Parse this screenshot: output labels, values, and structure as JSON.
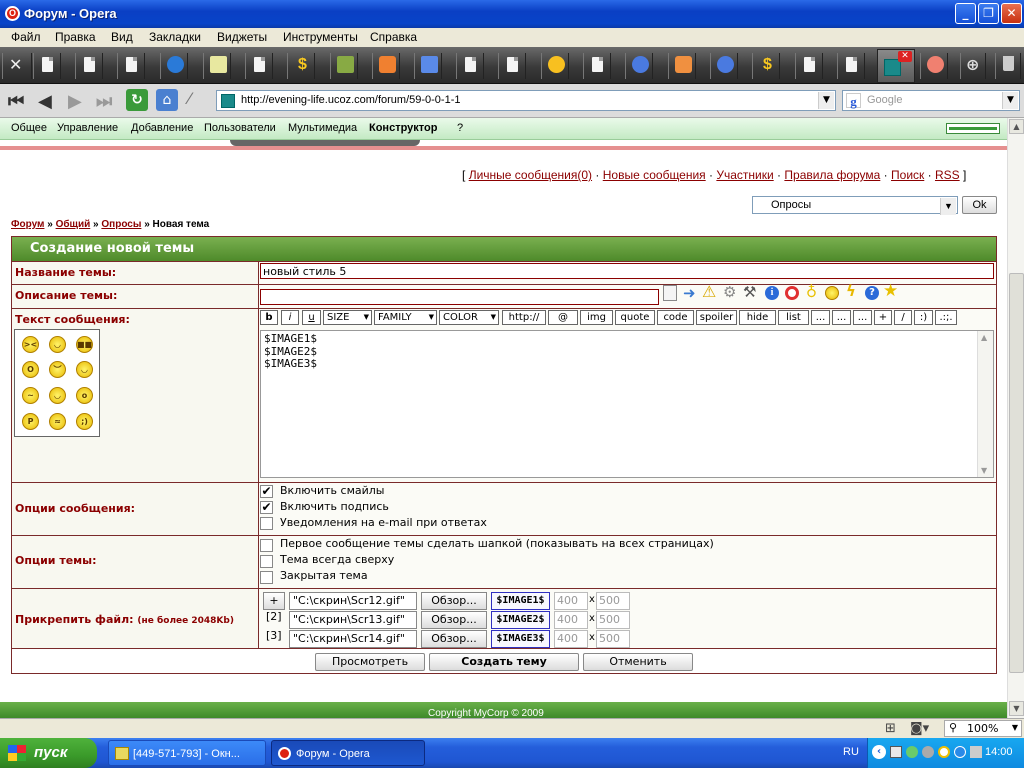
{
  "window": {
    "title": "Форум - Opera",
    "logo": "O"
  },
  "window_buttons": {
    "minimize": "_",
    "maximize": "❐",
    "close": "✕"
  },
  "menu": [
    "Файл",
    "Правка",
    "Вид",
    "Закладки",
    "Виджеты",
    "Инструменты",
    "Справка"
  ],
  "address": {
    "url": "http://evening-life.ucoz.com/forum/59-0-0-1-1"
  },
  "search": {
    "placeholder": "Google",
    "logo": "g"
  },
  "ucoz_menu": [
    "Общее",
    "Управление",
    "Добавление",
    "Пользователи",
    "Мультимедиа",
    "Конструктор",
    "?"
  ],
  "top_links": {
    "open": "[",
    "close": "]",
    "sep": "·",
    "items": [
      "Личные сообщения(0)",
      "Новые сообщения",
      "Участники",
      "Правила форума",
      "Поиск",
      "RSS"
    ]
  },
  "forum_jump": {
    "selected": "Опросы",
    "ok": "Ok"
  },
  "breadcrumb": {
    "items": [
      "Форум",
      "Общий",
      "Опросы"
    ],
    "sep": "»",
    "current": "Новая тема"
  },
  "form": {
    "header": "Создание новой темы",
    "title_label": "Название темы:",
    "title_value": "новый стиль 5",
    "desc_label": "Описание темы:",
    "desc_value": "",
    "text_label": "Текст сообщения:",
    "message": "$IMAGE1$\n$IMAGE2$\n$IMAGE3$",
    "toolbar": [
      "b",
      "i",
      "u",
      "SIZE",
      "FAMILY",
      "COLOR",
      "http://",
      "@",
      "img",
      "quote",
      "code",
      "spoiler",
      "hide",
      "list",
      "...",
      "...",
      "...",
      "+",
      "/",
      ":)",
      ".:;."
    ],
    "msg_opts_label": "Опции сообщения:",
    "msg_opts": [
      {
        "label": "Включить смайлы",
        "checked": true
      },
      {
        "label": "Включить подпись",
        "checked": true
      },
      {
        "label": "Уведомления на e-mail при ответах",
        "checked": false
      }
    ],
    "topic_opts_label": "Опции темы:",
    "topic_opts": [
      {
        "label": "Первое сообщение темы сделать шапкой (показывать на всех страницах)",
        "checked": false
      },
      {
        "label": "Тема всегда сверху",
        "checked": false
      },
      {
        "label": "Закрытая тема",
        "checked": false
      }
    ],
    "attach_label": "Прикрепить файл:",
    "attach_note": "(не более 2048Kb)",
    "attach_add": "+",
    "attachments": [
      {
        "num": "",
        "path": "\"C:\\скрин\\Scr12.gif\"",
        "browse": "Обзор...",
        "tag": "$IMAGE1$",
        "w": "400",
        "x": "x",
        "h": "500"
      },
      {
        "num": "[2]",
        "path": "\"C:\\скрин\\Scr13.gif\"",
        "browse": "Обзор...",
        "tag": "$IMAGE2$",
        "w": "400",
        "x": "x",
        "h": "500"
      },
      {
        "num": "[3]",
        "path": "\"C:\\скрин\\Scr14.gif\"",
        "browse": "Обзор...",
        "tag": "$IMAGE3$",
        "w": "400",
        "x": "x",
        "h": "500"
      }
    ],
    "buttons": {
      "preview": "Просмотреть",
      "submit": "Создать тему",
      "cancel": "Отменить"
    }
  },
  "footer_text": "Copyright MyCorp © 2009",
  "status": {
    "zoom": "100%"
  },
  "taskbar": {
    "start": "пуск",
    "tasks": [
      "[449-571-793] - Окн...",
      "Форум - Opera"
    ],
    "lang": "RU",
    "clock": "14:00"
  },
  "colors": {
    "accent_green": "#4e8a2a",
    "link": "#8b0000",
    "border": "#7a2a2a"
  }
}
